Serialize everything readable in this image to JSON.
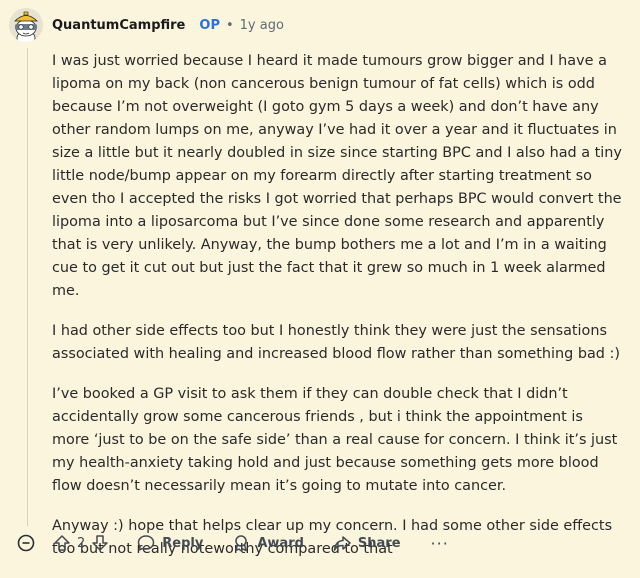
{
  "comment": {
    "username": "QuantumCampfire",
    "op_badge": "OP",
    "separator": "•",
    "time": "1y ago",
    "paragraphs": [
      "I was just worried because I heard it made tumours grow bigger and I have a lipoma on my back (non cancerous benign tumour of fat cells) which is odd because I’m not overweight (I goto gym 5 days a week) and don’t have any other random lumps on me, anyway I’ve had it over a year and it fluctuates in size a little but it nearly doubled in size since starting BPC and I also had a tiny little node/bump appear on my forearm directly after starting treatment so even tho I accepted the risks I got worried that perhaps BPC would convert the lipoma into a liposarcoma but I’ve since done some research and apparently that is very unlikely. Anyway, the bump bothers me a lot and I’m in a waiting cue to get it cut out but just the fact that it grew so much in 1 week alarmed me.",
      "I had other side effects too but I honestly think they were just the sensations associated with healing and increased blood flow rather than something bad :)",
      "I’ve booked a GP visit to ask them if they can double check that I didn’t accidentally grow some cancerous friends , but i think the appointment is more ‘just to be on the safe side’ than a real cause for concern. I think it’s just my health-anxiety taking hold and just because something gets more blood flow doesn’t necessarily mean it’s going to mutate into cancer.",
      "Anyway :) hope that helps clear up my concern. I had some other side effects too but not really noteworthy compared to that"
    ]
  },
  "actions": {
    "vote_count": "2",
    "reply_label": "Reply",
    "award_label": "Award",
    "share_label": "Share",
    "more_label": "···"
  },
  "icons": {
    "avatar": "snoo-avatar-icon",
    "collapse": "collapse-minus-icon",
    "upvote": "upvote-arrow-icon",
    "downvote": "downvote-arrow-icon",
    "reply": "speech-bubble-icon",
    "award": "award-ribbon-icon",
    "share": "share-arrow-icon"
  }
}
